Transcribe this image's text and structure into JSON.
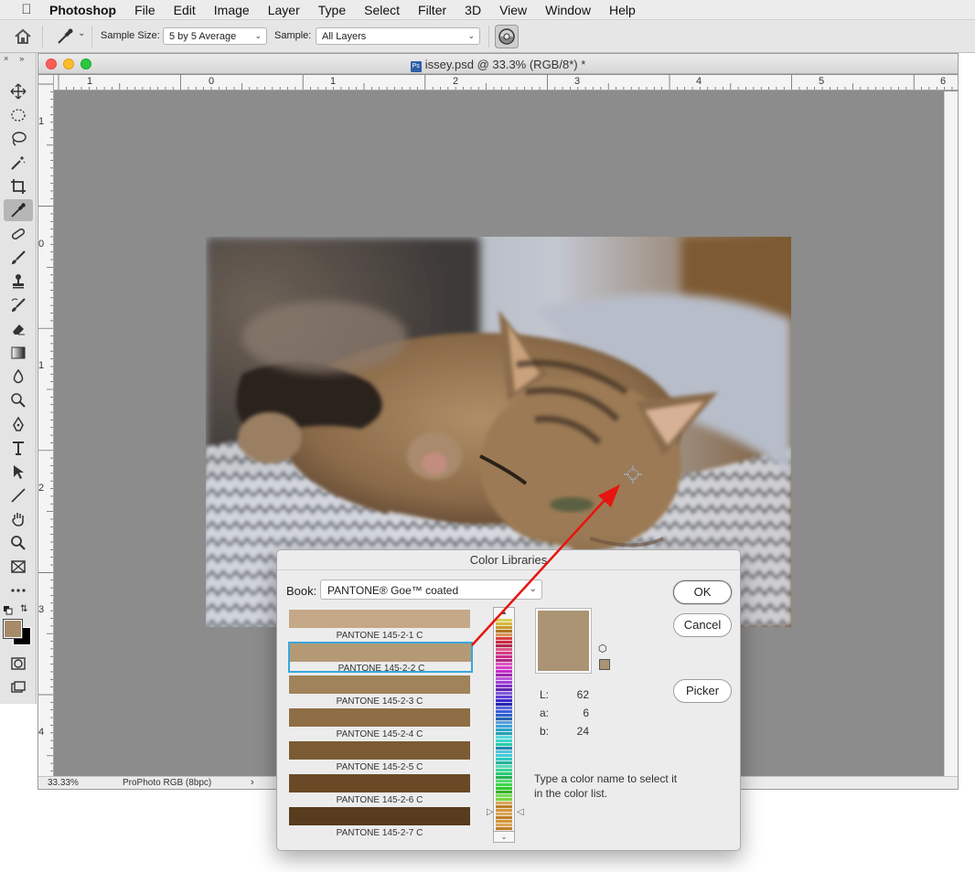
{
  "menubar": {
    "app": "Photoshop",
    "items": [
      "File",
      "Edit",
      "Image",
      "Layer",
      "Type",
      "Select",
      "Filter",
      "3D",
      "View",
      "Window",
      "Help"
    ]
  },
  "options": {
    "sample_size_label": "Sample Size:",
    "sample_size_value": "5 by 5 Average",
    "sample_label": "Sample:",
    "sample_value": "All Layers"
  },
  "document": {
    "filename": "issey.psd @ 33.3% (RGB/8*) *",
    "badge": "Ps",
    "hruler_labels": [
      "1",
      "0",
      "1",
      "2",
      "3",
      "4",
      "5",
      "6"
    ],
    "vruler_labels": [
      "1",
      "0",
      "1",
      "2",
      "3",
      "4"
    ],
    "status_zoom": "33.33%",
    "status_profile": "ProPhoto RGB (8bpc)",
    "status_more": "›"
  },
  "foreground_color": "#a68a6a",
  "dialog": {
    "title": "Color Libraries",
    "book_label": "Book:",
    "book_value": "PANTONE® Goe™ coated",
    "swatches": [
      {
        "name": "PANTONE 145-2-1 C",
        "color": "#c4a887"
      },
      {
        "name": "PANTONE 145-2-2 C",
        "color": "#b39a75"
      },
      {
        "name": "PANTONE 145-2-3 C",
        "color": "#a0835a"
      },
      {
        "name": "PANTONE 145-2-4 C",
        "color": "#8e6e45"
      },
      {
        "name": "PANTONE 145-2-5 C",
        "color": "#7b5b34"
      },
      {
        "name": "PANTONE 145-2-6 C",
        "color": "#6a4a26"
      },
      {
        "name": "PANTONE 145-2-7 C",
        "color": "#573c1d"
      }
    ],
    "selected_index": 1,
    "preview_color": "#ab9474",
    "lab": {
      "L": "62",
      "a": "6",
      "b": "24"
    },
    "lab_labels": {
      "L": "L:",
      "a": "a:",
      "b": "b:"
    },
    "hint": "Type a color name to select it in the color list.",
    "ok_label": "OK",
    "cancel_label": "Cancel",
    "picker_label": "Picker"
  }
}
